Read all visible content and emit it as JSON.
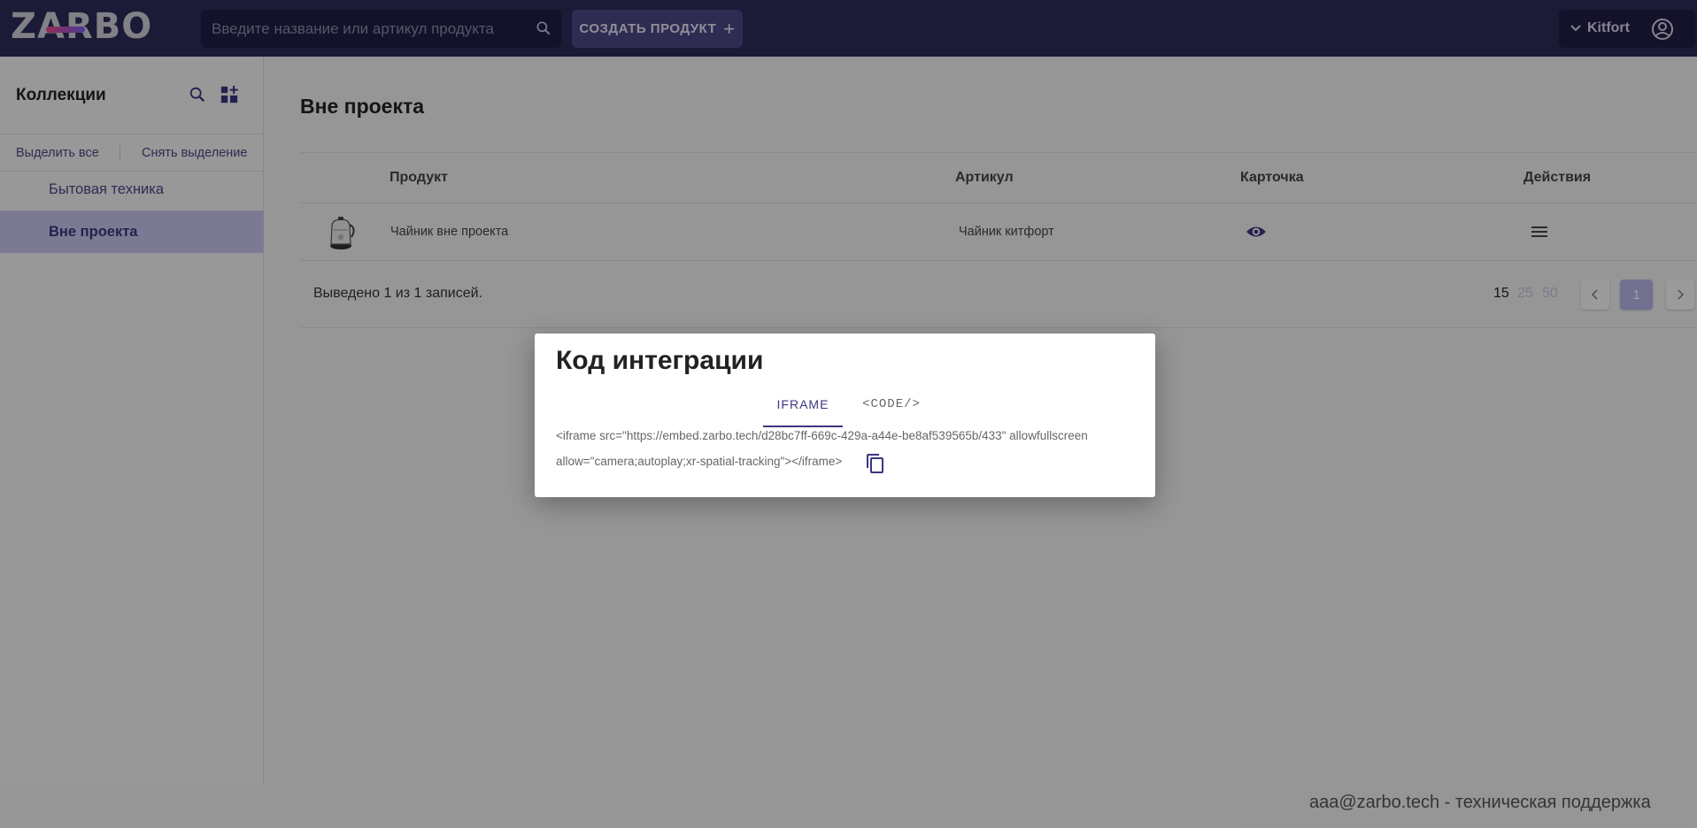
{
  "header": {
    "logo": "ZARBO",
    "search_placeholder": "Введите название или артикул продукта",
    "create_label": "СОЗДАТЬ ПРОДУКТ",
    "account_name": "Kitfort"
  },
  "sidebar": {
    "title": "Коллекции",
    "select_all": "Выделить все",
    "deselect": "Снять выделение",
    "items": [
      {
        "label": "Бытовая техника",
        "active": false
      },
      {
        "label": "Вне проекта",
        "active": true
      }
    ]
  },
  "main": {
    "title": "Вне проекта",
    "columns": [
      "Продукт",
      "Артикул",
      "Карточка",
      "Действия"
    ],
    "rows": [
      {
        "product": "Чайник вне проекта",
        "article": "Чайник китфорт"
      }
    ],
    "summary": "Выведено 1 из 1 записей.",
    "page_sizes": [
      "15",
      "25",
      "50"
    ],
    "current_page": "1"
  },
  "footer": {
    "support": "aaa@zarbo.tech - техническая поддержка"
  },
  "dialog": {
    "title": "Код интеграции",
    "tabs": [
      "IFRAME",
      "<CODE/>"
    ],
    "code_line1": "<iframe src=\"https://embed.zarbo.tech/d28bc7ff-669c-429a-a44e-be8af539565b/433\" allowfullscreen",
    "code_line2": "allow=\"camera;autoplay;xr-spatial-tracking\"></iframe>"
  },
  "colors": {
    "header_bg": "#2d2a5a",
    "accent": "#3b3680",
    "selected_bg": "#c9c6ec"
  }
}
